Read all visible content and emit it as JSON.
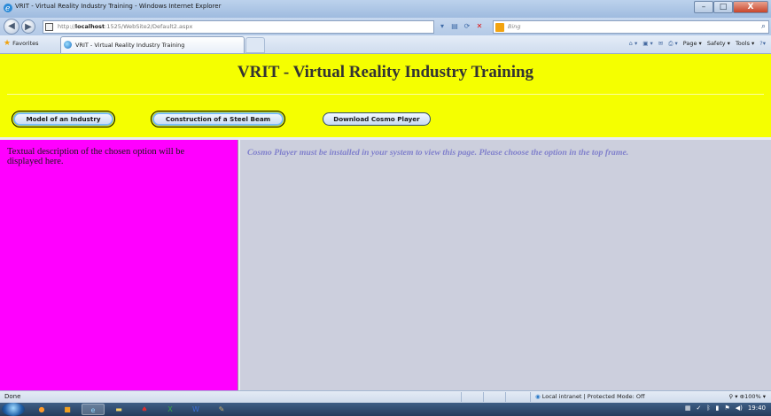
{
  "window": {
    "title": "VRIT - Virtual Reality Industry Training - Windows Internet Explorer",
    "controls": {
      "minimize": "–",
      "maximize": "□",
      "close": "X"
    }
  },
  "address_bar": {
    "url_prefix": "http://",
    "url_host": "localhost",
    "url_rest": ":1525/WebSite2/Default2.aspx",
    "search_placeholder": "Bing"
  },
  "favorites_bar": {
    "favorites_label": "Favorites",
    "tab_label": "VRIT - Virtual Reality Industry Training",
    "commands": {
      "page": "Page ▾",
      "safety": "Safety ▾",
      "tools": "Tools ▾"
    }
  },
  "top_frame": {
    "title": "VRIT - Virtual Reality Industry Training",
    "buttons": [
      {
        "label": "Model of an Industry"
      },
      {
        "label": "Construction of a Steel Beam"
      },
      {
        "label": "Download Cosmo Player"
      }
    ]
  },
  "left_frame": {
    "text": "Textual description of the chosen option will be displayed here."
  },
  "right_frame": {
    "text": "Cosmo Player must be installed in your system to view this page. Please choose the option in the top frame."
  },
  "status_bar": {
    "status": "Done",
    "zone": "Local intranet | Protected Mode: Off",
    "zoom": "100%"
  },
  "taskbar": {
    "clock": "19:40"
  },
  "colors": {
    "top_frame_bg": "#f5ff00",
    "left_frame_bg": "#ff00ff",
    "right_frame_bg": "#cccfdd",
    "right_text": "#8080cc"
  }
}
